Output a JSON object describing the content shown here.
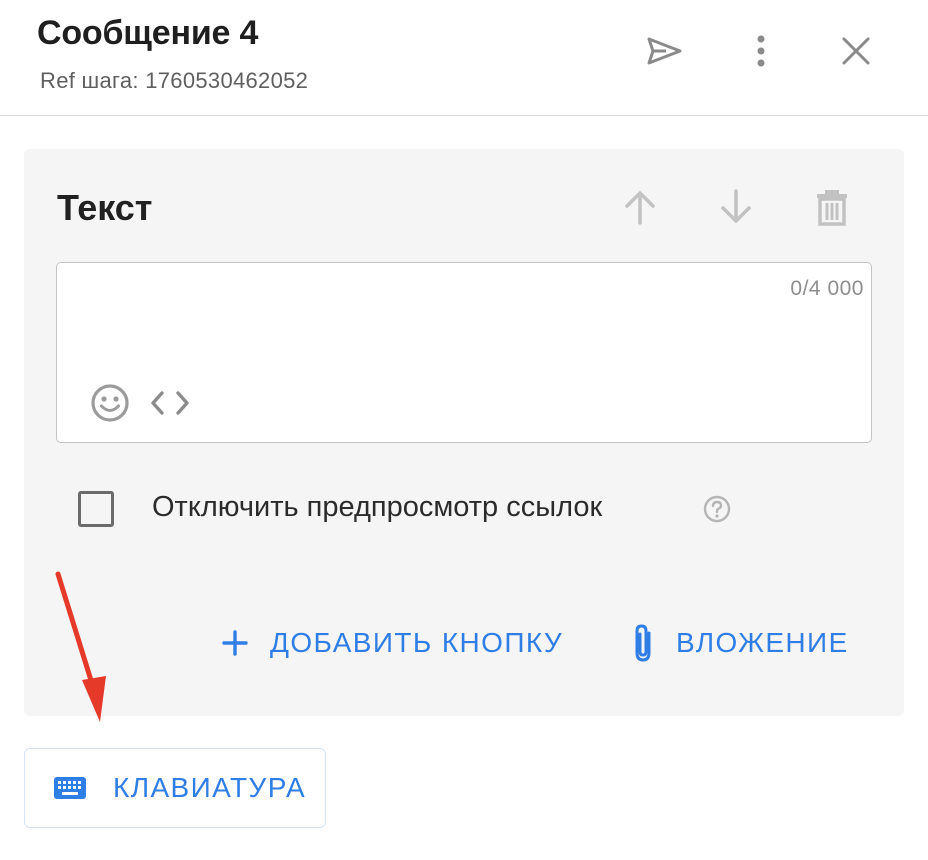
{
  "header": {
    "title": "Сообщение 4",
    "ref": "Ref шага: 1760530462052",
    "actions": {
      "send_icon": "send-icon",
      "more_icon": "more-vert-icon",
      "close_icon": "close-icon"
    }
  },
  "block": {
    "title": "Текст",
    "icons": {
      "up": "arrow-up-icon",
      "down": "arrow-down-icon",
      "delete": "trash-icon"
    },
    "text_value": "",
    "counter": "0/4 000",
    "toolbar_icons": [
      "emoji-icon",
      "code-icon"
    ]
  },
  "options": {
    "disable_preview_label": "Отключить предпросмотр ссылок",
    "disable_preview_checked": false
  },
  "actions": {
    "add_button_label": "ДОБАВИТЬ КНОПКУ",
    "attachment_label": "ВЛОЖЕНИЕ"
  },
  "keyboard": {
    "label": "КЛАВИАТУРА"
  },
  "colors": {
    "accent": "#2f7ee6",
    "annotation_arrow": "#e53a2a",
    "card_bg": "#f5f5f5"
  }
}
